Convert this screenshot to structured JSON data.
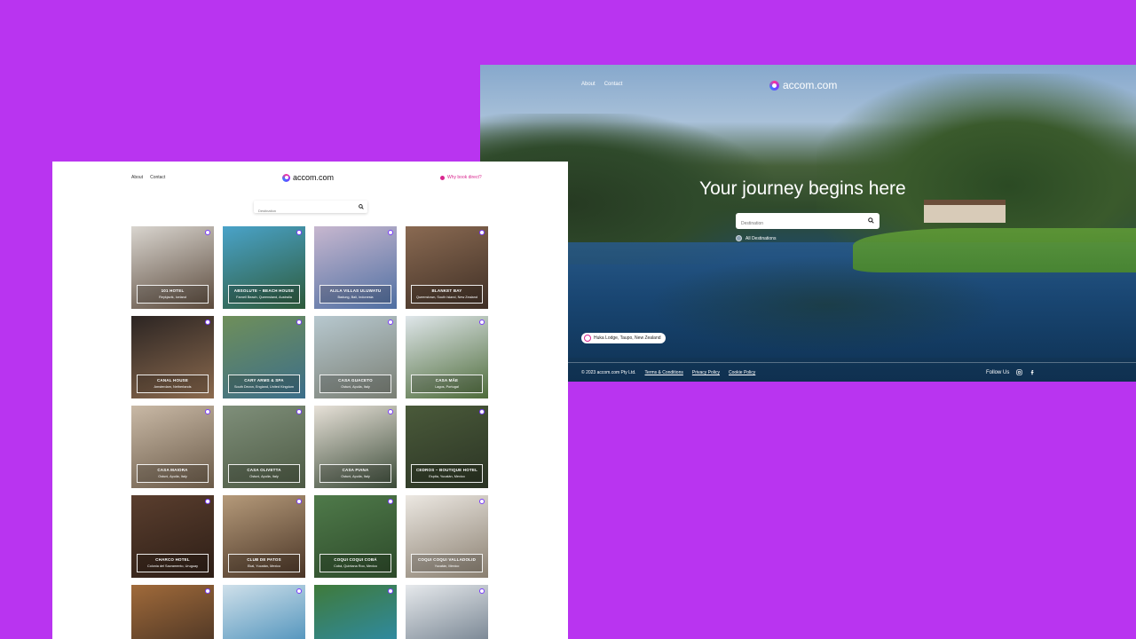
{
  "hero": {
    "nav": [
      "About",
      "Contact"
    ],
    "logo_text": "accom.com",
    "title": "Your journey begins here",
    "search_placeholder": "Destination",
    "destinations_label": "All Destinations",
    "location_pill": "Huka Lodge, Taupo, New Zealand",
    "footer": {
      "copyright": "© 2023 accom.com Pty Ltd.",
      "links": [
        "Terms & Conditions",
        "Privacy Policy",
        "Cookie Policy"
      ],
      "follow": "Follow Us"
    },
    "icons": [
      "search-icon",
      "globe-icon",
      "location-pin-icon",
      "instagram-icon",
      "facebook-icon"
    ]
  },
  "listing": {
    "nav": [
      "About",
      "Contact"
    ],
    "logo_text": "accom.com",
    "why_link": "Why book direct?",
    "search_placeholder": "Destination",
    "cards": [
      {
        "name": "101 HOTEL",
        "loc": "Reykjavík, Iceland",
        "colors": [
          "#d9d5cf",
          "#5b4a3c"
        ]
      },
      {
        "name": "ABSOLUTE – BEACH HOUSE",
        "loc": "Farnell Beach, Queensland, Australia",
        "colors": [
          "#4aa3c9",
          "#2d5a3a"
        ]
      },
      {
        "name": "ALILA VILLAS ULUWATU",
        "loc": "Badung, Bali, Indonesia",
        "colors": [
          "#c7b7cf",
          "#4f6fa2"
        ]
      },
      {
        "name": "BLANKET BAY",
        "loc": "Queenstown, South Island, New Zealand",
        "colors": [
          "#8a6a52",
          "#3f2f25"
        ]
      },
      {
        "name": "CANAL HOUSE",
        "loc": "Amsterdam, Netherlands",
        "colors": [
          "#2c2523",
          "#8b6a4e"
        ]
      },
      {
        "name": "CARY ARMS & SPA",
        "loc": "South Devon, England, United Kingdom",
        "colors": [
          "#6f8f5a",
          "#3c6e8a"
        ]
      },
      {
        "name": "CASA GUACETO",
        "loc": "Ostuni, Apulia, Italy",
        "colors": [
          "#b7c8cf",
          "#7a7f74"
        ]
      },
      {
        "name": "CASA MÃE",
        "loc": "Lagos, Portugal",
        "colors": [
          "#dfe6ea",
          "#4e6c3a"
        ]
      },
      {
        "name": "CASA MAIORA",
        "loc": "Ostuni, Apulia, Italy",
        "colors": [
          "#c9b9a6",
          "#6a5a48"
        ]
      },
      {
        "name": "CASA OLIVETTA",
        "loc": "Ostuni, Apulia, Italy",
        "colors": [
          "#7f8f7a",
          "#4d5a44"
        ]
      },
      {
        "name": "CASA PIANA",
        "loc": "Ostuni, Apulia, Italy",
        "colors": [
          "#e7e1d8",
          "#3b4b38"
        ]
      },
      {
        "name": "CEDROS – BOUTIQUE HOTEL",
        "loc": "Espita, Yucatán, Mexico",
        "colors": [
          "#4a5a3a",
          "#2b3424"
        ]
      },
      {
        "name": "CHARCO HOTEL",
        "loc": "Colonia del Sacramento, Uruguay",
        "colors": [
          "#5a3e2e",
          "#2d1e16"
        ]
      },
      {
        "name": "CLUB DE PATOS",
        "loc": "Ekal, Yucatán, Mexico",
        "colors": [
          "#b59a7a",
          "#4a3526"
        ]
      },
      {
        "name": "COQUI COQUI COBÁ",
        "loc": "Cobá, Quintana Roo, Mexico",
        "colors": [
          "#4f7a4a",
          "#2d4a2a"
        ]
      },
      {
        "name": "COQUI COQUI VALLADOLID",
        "loc": "Yucatán, Mexico",
        "colors": [
          "#ece8e2",
          "#8a7f70"
        ]
      },
      {
        "name": "",
        "loc": "",
        "colors": [
          "#a06a3a",
          "#3a2a20"
        ]
      },
      {
        "name": "",
        "loc": "",
        "colors": [
          "#cfe0ea",
          "#2f7fb0"
        ]
      },
      {
        "name": "",
        "loc": "",
        "colors": [
          "#3f7a3a",
          "#2a8fc0"
        ]
      },
      {
        "name": "",
        "loc": "",
        "colors": [
          "#e6e9ec",
          "#5a6a7a"
        ]
      }
    ]
  }
}
